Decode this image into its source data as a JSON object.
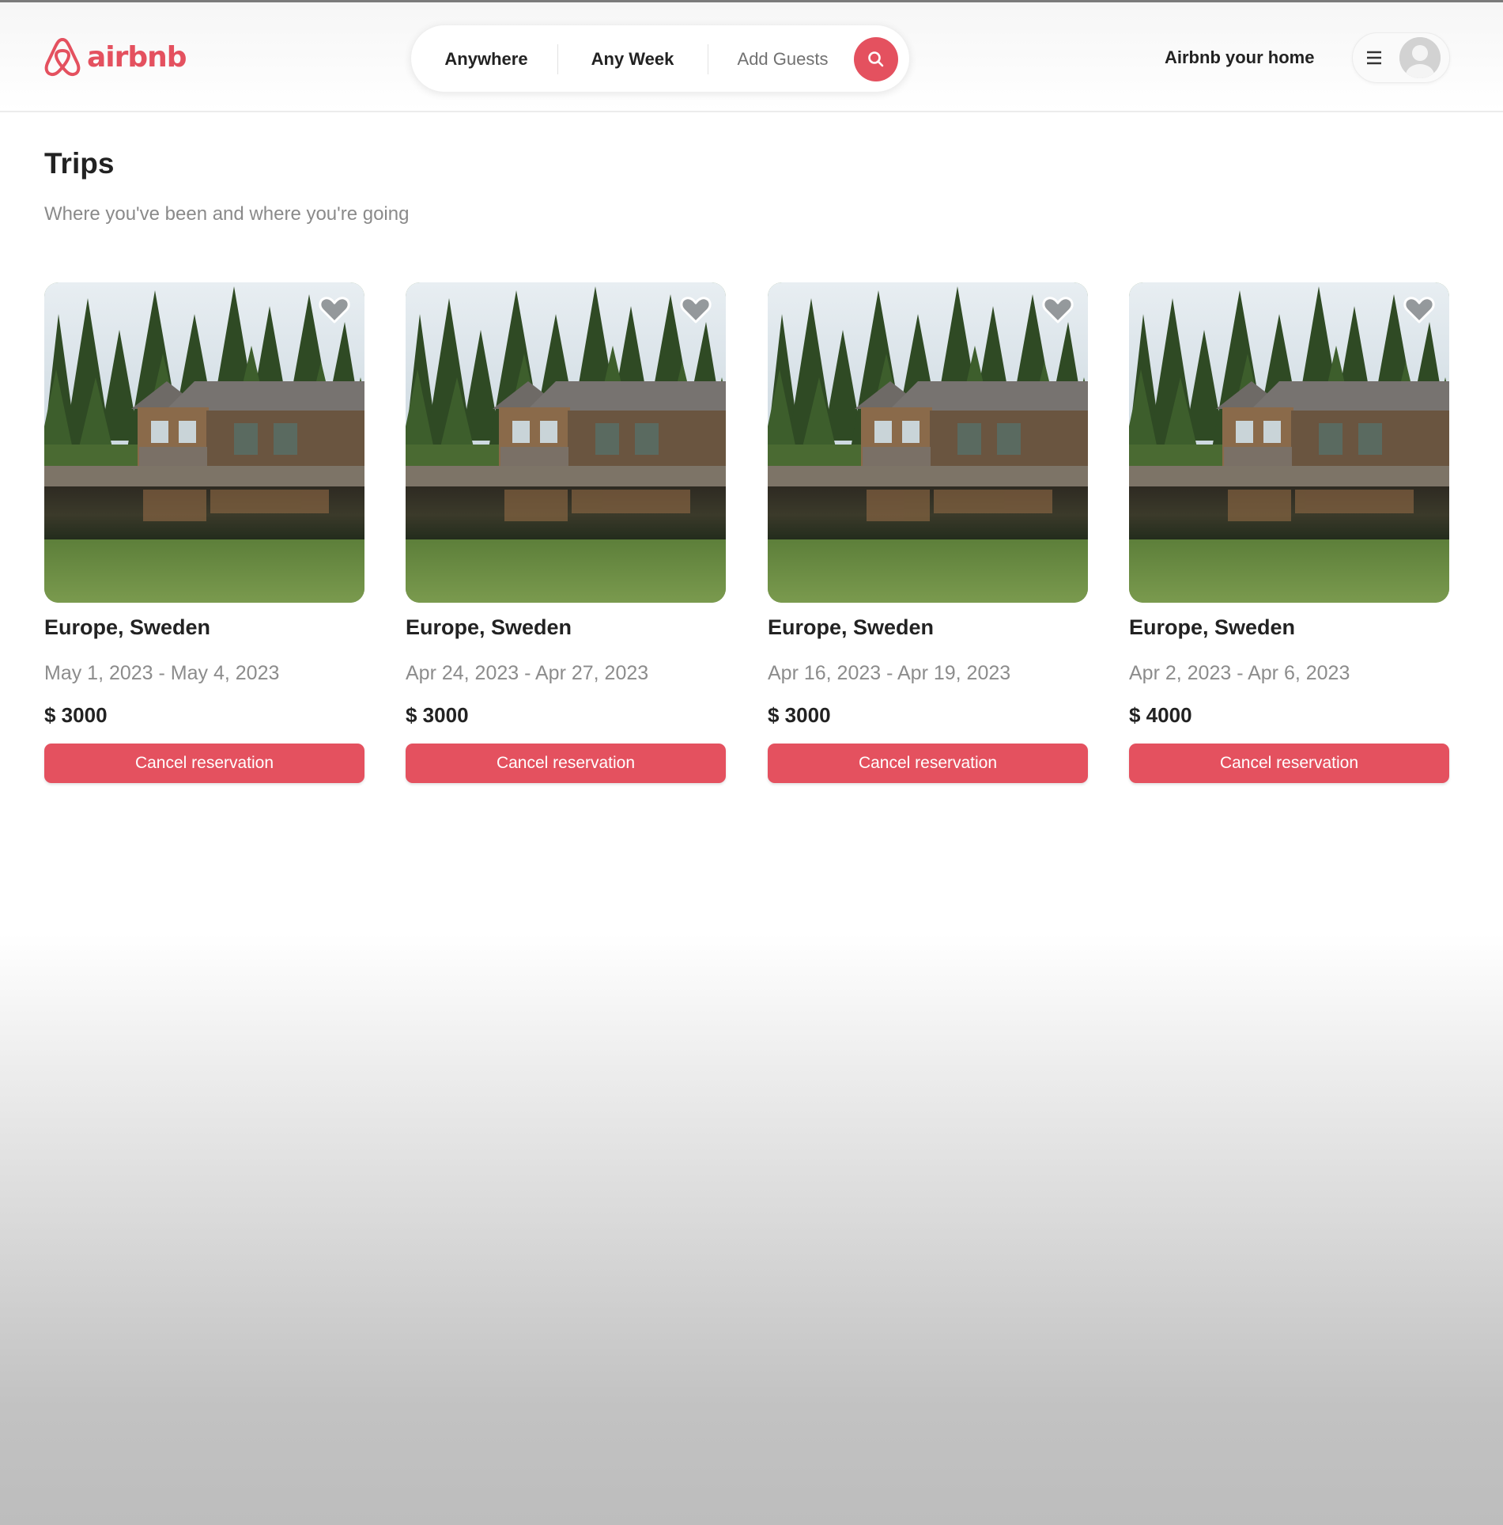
{
  "brand": {
    "name": "airbnb",
    "accent_color": "#e4515f",
    "logo_icon": "airbnb-logo-icon"
  },
  "search": {
    "location": "Anywhere",
    "week": "Any Week",
    "guests": "Add Guests",
    "icon": "search-icon"
  },
  "nav": {
    "host_link": "Airbnb your home",
    "menu_icon": "hamburger-menu-icon",
    "avatar_icon": "user-avatar-icon"
  },
  "page": {
    "title": "Trips",
    "subtitle": "Where you've been and where you're going"
  },
  "trips": [
    {
      "location": "Europe, Sweden",
      "dates": "May 1, 2023 - May 4, 2023",
      "price": "$ 3000",
      "action": "Cancel reservation"
    },
    {
      "location": "Europe, Sweden",
      "dates": "Apr 24, 2023 - Apr 27, 2023",
      "price": "$ 3000",
      "action": "Cancel reservation"
    },
    {
      "location": "Europe, Sweden",
      "dates": "Apr 16, 2023 - Apr 19, 2023",
      "price": "$ 3000",
      "action": "Cancel reservation"
    },
    {
      "location": "Europe, Sweden",
      "dates": "Apr 2, 2023 - Apr 6, 2023",
      "price": "$ 4000",
      "action": "Cancel reservation"
    }
  ]
}
